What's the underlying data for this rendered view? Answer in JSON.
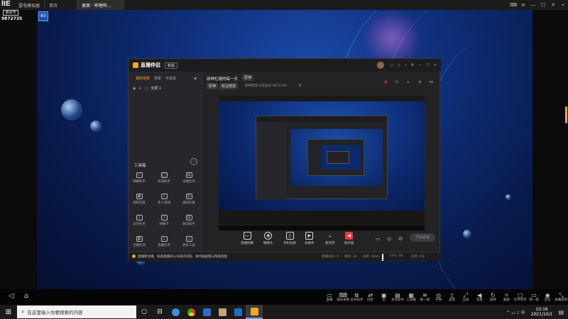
{
  "emulator": {
    "brand": "ltE",
    "room_label": "房间号",
    "room_id": "9872735",
    "badge": "83",
    "tabs": [
      {
        "label": "雷电模拟器"
      },
      {
        "label": "首页"
      },
      {
        "label": "桌面 · 哔哩哔..."
      }
    ],
    "bottom_icons": [
      {
        "icon": "screen-record-icon",
        "label": "直播"
      },
      {
        "icon": "keyboard-icon",
        "label": "操作录制"
      },
      {
        "icon": "multi-open-icon",
        "label": "多开助手"
      },
      {
        "icon": "sync-icon",
        "label": "同步"
      },
      {
        "icon": "macro-icon",
        "label": "宏"
      },
      {
        "icon": "screenshot-icon",
        "label": "多开助手"
      },
      {
        "icon": "tools-icon",
        "label": "工具箱"
      },
      {
        "icon": "shake-icon",
        "label": "摇一摇"
      },
      {
        "icon": "gamepad-icon",
        "label": "手柄"
      },
      {
        "icon": "install-icon",
        "label": "安装"
      },
      {
        "icon": "volume-icon",
        "label": "全屏"
      },
      {
        "icon": "record-icon",
        "label": "音量"
      },
      {
        "icon": "rotate-icon",
        "label": "旋转"
      },
      {
        "icon": "crop-icon",
        "label": "截屏"
      },
      {
        "icon": "file-icon",
        "label": "文件共享"
      },
      {
        "icon": "window-icon",
        "label": "摇一摇"
      },
      {
        "icon": "location-icon",
        "label": "定位"
      },
      {
        "icon": "screen-icon",
        "label": "屏幕旋转"
      }
    ]
  },
  "app": {
    "logo": "直播伴侣",
    "version_badge": "新版",
    "stream_title": "原神忆德的每一天",
    "tag": "原神",
    "category": "原神",
    "edit_label": "标注修改",
    "room_text": "原神游戏·分区总长 9872735",
    "likes": "0",
    "left_tabs": [
      "我的场景",
      "场景",
      "可道具"
    ],
    "scene_name": "全屏 1",
    "tools_header": "工具箱",
    "tools": [
      {
        "label": "弹幕助手"
      },
      {
        "label": "房管助手"
      },
      {
        "label": "主播任务"
      },
      {
        "label": "视频连麦"
      },
      {
        "label": "多人连线"
      },
      {
        "label": "虚拟形象"
      },
      {
        "label": "派对任务"
      },
      {
        "label": "弹幕卡"
      },
      {
        "label": "歌词助手"
      },
      {
        "label": "主播任务"
      },
      {
        "label": "直播任务"
      },
      {
        "label": "更多工具"
      }
    ],
    "controls": [
      {
        "icon": "screen-capture-icon",
        "label": "直播屏幕"
      },
      {
        "icon": "camera-icon",
        "label": "摄像头"
      },
      {
        "icon": "phone-cast-icon",
        "label": "手机投屏"
      },
      {
        "icon": "media-icon",
        "label": "多媒体"
      },
      {
        "icon": "mic-icon",
        "label": "麦克风"
      },
      {
        "icon": "speaker-icon",
        "label": "扬声器"
      }
    ],
    "start_button": "开始直播",
    "notice": "直播新主播，知道直播间公众知识问答，请点按查看与帮助答复",
    "status": [
      "直播间ID: 0",
      "帧率: 30",
      "码率: 0kb/s",
      "CPU: 0%",
      "内存: 0%"
    ]
  },
  "taskbar": {
    "search_placeholder": "在这里输入你要搜索的内容",
    "time": "10:16",
    "date": "2021/10/1"
  },
  "colors": {
    "accent": "#f5a623",
    "wallpaper": "#0f2f7a",
    "red": "#e43b3b"
  }
}
